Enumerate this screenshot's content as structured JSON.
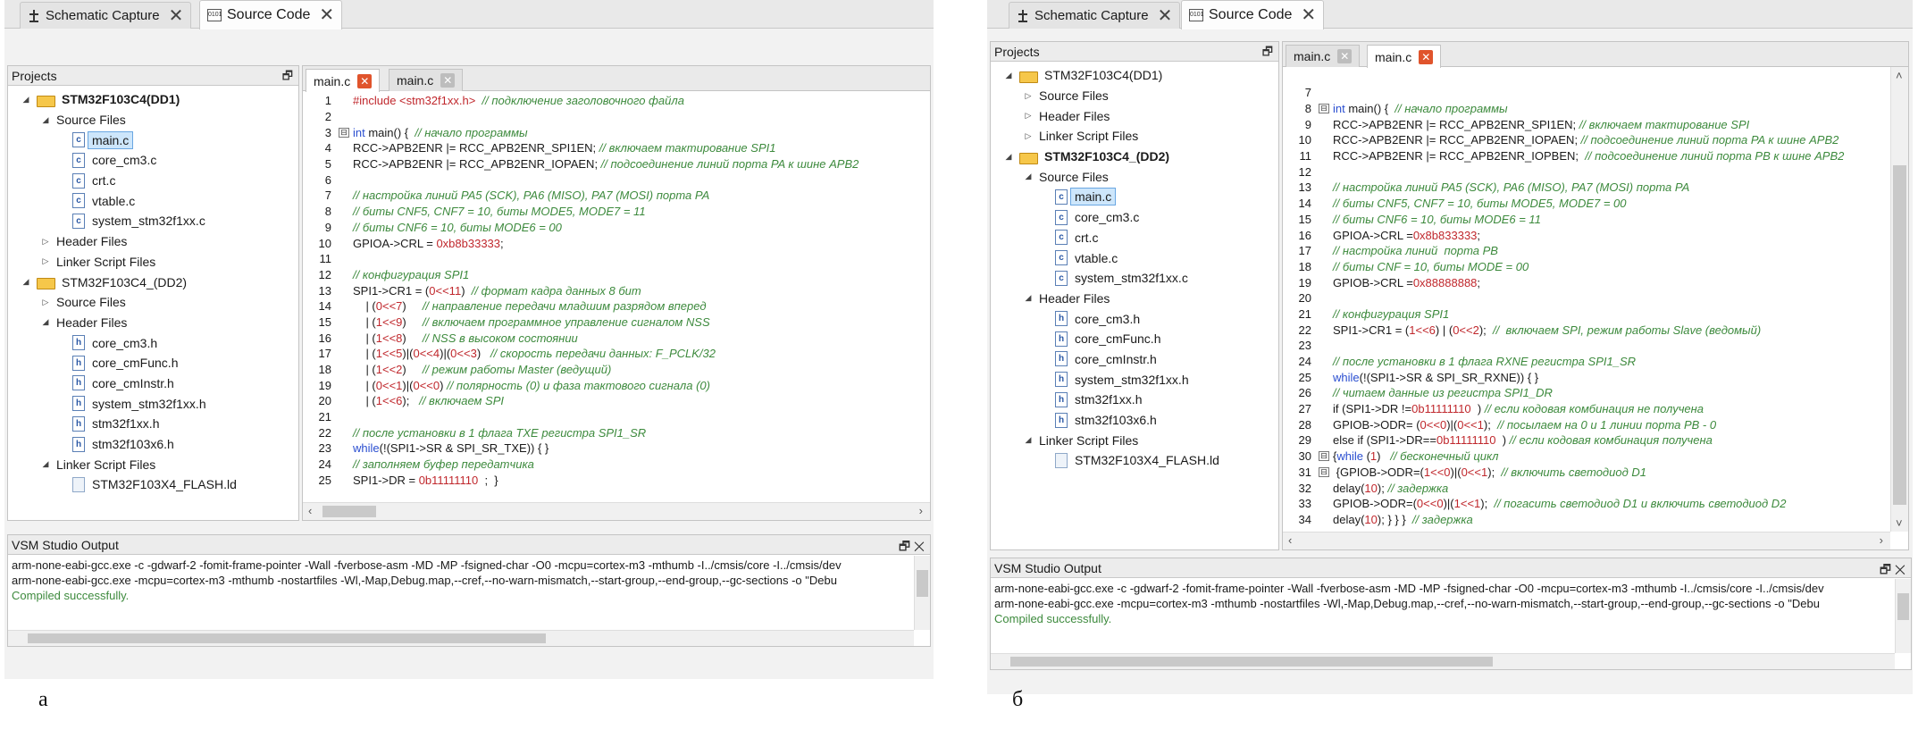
{
  "tabs": {
    "schematic": "Schematic Capture",
    "source": "Source Code"
  },
  "projects_title": "Projects",
  "output_title": "VSM Studio Output",
  "output_lines": [
    "arm-none-eabi-gcc.exe -c -gdwarf-2 -fomit-frame-pointer -Wall -fverbose-asm -MD -MP -fsigned-char -O0 -mcpu=cortex-m3 -mthumb -I../cmsis/core -I../cmsis/dev",
    "arm-none-eabi-gcc.exe -mcpu=cortex-m3 -mthumb -nostartfiles  -Wl,-Map,Debug.map,--cref,--no-warn-mismatch,--start-group,--end-group,--gc-sections -o \"Debu",
    "Compiled successfully."
  ],
  "output_lines_b": [
    "arm-none-eabi-gcc.exe -c -gdwarf-2 -fomit-frame-pointer -Wall -fverbose-asm -MD -MP -fsigned-char -O0 -mcpu=cortex-m3 -mthumb -I../cmsis/core -I../cmsis/dev",
    "arm-none-eabi-gcc.exe -mcpu=cortex-m3 -mthumb -nostartfiles  -Wl,-Map,Debug.map,--cref,--no-warn-mismatch,--start-group,--end-group,--gc-sections -o \"Debu",
    "Compiled successfully."
  ],
  "panel_a": {
    "caption": "а",
    "tree": [
      {
        "t": "STM32F103C4(DD1)",
        "lvl": 0,
        "arrow": "◢",
        "icon": "folder",
        "bold": true
      },
      {
        "t": "Source Files",
        "lvl": 1,
        "arrow": "◢",
        "icon": ""
      },
      {
        "t": "main.c",
        "lvl": 2,
        "arrow": "",
        "icon": "c",
        "sel": true
      },
      {
        "t": "core_cm3.c",
        "lvl": 2,
        "arrow": "",
        "icon": "c"
      },
      {
        "t": "crt.c",
        "lvl": 2,
        "arrow": "",
        "icon": "c"
      },
      {
        "t": "vtable.c",
        "lvl": 2,
        "arrow": "",
        "icon": "c"
      },
      {
        "t": "system_stm32f1xx.c",
        "lvl": 2,
        "arrow": "",
        "icon": "c"
      },
      {
        "t": "Header Files",
        "lvl": 1,
        "arrow": "▷",
        "icon": ""
      },
      {
        "t": "Linker Script Files",
        "lvl": 1,
        "arrow": "▷",
        "icon": ""
      },
      {
        "t": "STM32F103C4_(DD2)",
        "lvl": 0,
        "arrow": "◢",
        "icon": "folder"
      },
      {
        "t": "Source Files",
        "lvl": 1,
        "arrow": "▷",
        "icon": ""
      },
      {
        "t": "Header Files",
        "lvl": 1,
        "arrow": "◢",
        "icon": ""
      },
      {
        "t": "core_cm3.h",
        "lvl": 2,
        "arrow": "",
        "icon": "h"
      },
      {
        "t": "core_cmFunc.h",
        "lvl": 2,
        "arrow": "",
        "icon": "h"
      },
      {
        "t": "core_cmInstr.h",
        "lvl": 2,
        "arrow": "",
        "icon": "h"
      },
      {
        "t": "system_stm32f1xx.h",
        "lvl": 2,
        "arrow": "",
        "icon": "h"
      },
      {
        "t": "stm32f1xx.h",
        "lvl": 2,
        "arrow": "",
        "icon": "h"
      },
      {
        "t": "stm32f103x6.h",
        "lvl": 2,
        "arrow": "",
        "icon": "h"
      },
      {
        "t": "Linker Script Files",
        "lvl": 1,
        "arrow": "◢",
        "icon": ""
      },
      {
        "t": "STM32F103X4_FLASH.ld",
        "lvl": 2,
        "arrow": "",
        "icon": "ld"
      }
    ],
    "editor_tabs": [
      {
        "label": "main.c",
        "active": true,
        "close": "red"
      },
      {
        "label": "main.c",
        "active": false,
        "close": "grey"
      }
    ],
    "code": [
      {
        "n": "1",
        "fold": "",
        "segs": [
          [
            "pp",
            "#include <stm32f1xx.h>"
          ],
          [
            "",
            "  "
          ],
          [
            "cm",
            "// подключение заголовочного файла"
          ]
        ]
      },
      {
        "n": "2",
        "fold": "",
        "segs": []
      },
      {
        "n": "3",
        "fold": "⊟",
        "segs": [
          [
            "kw",
            "int"
          ],
          [
            "",
            " main() {  "
          ],
          [
            "cm",
            "// начало программы"
          ]
        ]
      },
      {
        "n": "4",
        "fold": "",
        "segs": [
          [
            "",
            "RCC->APB2ENR |= RCC_APB2ENR_SPI1EN; "
          ],
          [
            "cm",
            "// включаем тактирование SPI1"
          ]
        ]
      },
      {
        "n": "5",
        "fold": "",
        "segs": [
          [
            "",
            "RCC->APB2ENR |= RCC_APB2ENR_IOPAEN; "
          ],
          [
            "cm",
            "// подсоединение линий порта PA к шине APB2"
          ]
        ]
      },
      {
        "n": "6",
        "fold": "",
        "segs": []
      },
      {
        "n": "7",
        "fold": "",
        "segs": [
          [
            "cm",
            "// настройка линий PA5 (SCK), PA6 (MISO), PA7 (MOSI) порта PA"
          ]
        ]
      },
      {
        "n": "8",
        "fold": "",
        "segs": [
          [
            "cm",
            "// биты CNF5, CNF7 = 10, биты MODE5, MODE7 = 11"
          ]
        ]
      },
      {
        "n": "9",
        "fold": "",
        "segs": [
          [
            "cm",
            "// биты CNF6 = 10, биты MODE6 = 00"
          ]
        ]
      },
      {
        "n": "10",
        "fold": "",
        "segs": [
          [
            "",
            "GPIOA->CRL = "
          ],
          [
            "nm",
            "0xb8b33333"
          ],
          [
            "",
            ";"
          ]
        ]
      },
      {
        "n": "11",
        "fold": "",
        "segs": []
      },
      {
        "n": "12",
        "fold": "",
        "segs": [
          [
            "cm",
            "// конфигурация SPI1"
          ]
        ]
      },
      {
        "n": "13",
        "fold": "",
        "segs": [
          [
            "",
            "SPI1->CR1 = ("
          ],
          [
            "nm",
            "0<<11"
          ],
          [
            "",
            ")  "
          ],
          [
            "cm",
            "// формат кадра данных 8 бит"
          ]
        ]
      },
      {
        "n": "14",
        "fold": "",
        "segs": [
          [
            "",
            "    | ("
          ],
          [
            "nm",
            "0<<7"
          ],
          [
            "",
            ")     "
          ],
          [
            "cm",
            "// направление передачи младшим разрядом вперед"
          ]
        ]
      },
      {
        "n": "15",
        "fold": "",
        "segs": [
          [
            "",
            "    | ("
          ],
          [
            "nm",
            "1<<9"
          ],
          [
            "",
            ")     "
          ],
          [
            "cm",
            "// включаем программное управление сигналом NSS"
          ]
        ]
      },
      {
        "n": "16",
        "fold": "",
        "segs": [
          [
            "",
            "    | ("
          ],
          [
            "nm",
            "1<<8"
          ],
          [
            "",
            ")     "
          ],
          [
            "cm",
            "// NSS в высоком состоянии"
          ]
        ]
      },
      {
        "n": "17",
        "fold": "",
        "segs": [
          [
            "",
            "    | ("
          ],
          [
            "nm",
            "1<<5"
          ],
          [
            "",
            ")|("
          ],
          [
            "nm",
            "0<<4"
          ],
          [
            "",
            ")|("
          ],
          [
            "nm",
            "0<<3"
          ],
          [
            "",
            ")   "
          ],
          [
            "cm",
            "// скорость передачи данных: F_PCLK/32"
          ]
        ]
      },
      {
        "n": "18",
        "fold": "",
        "segs": [
          [
            "",
            "    | ("
          ],
          [
            "nm",
            "1<<2"
          ],
          [
            "",
            ")     "
          ],
          [
            "cm",
            "// режим работы Master (ведущий)"
          ]
        ]
      },
      {
        "n": "19",
        "fold": "",
        "segs": [
          [
            "",
            "    | ("
          ],
          [
            "nm",
            "0<<1"
          ],
          [
            "",
            ")|("
          ],
          [
            "nm",
            "0<<0"
          ],
          [
            "",
            ") "
          ],
          [
            "cm",
            "// полярность (0) и фаза тактового сигнала (0)"
          ]
        ]
      },
      {
        "n": "20",
        "fold": "",
        "segs": [
          [
            "",
            "    | ("
          ],
          [
            "nm",
            "1<<6"
          ],
          [
            "",
            ");   "
          ],
          [
            "cm",
            "// включаем SPI"
          ]
        ]
      },
      {
        "n": "21",
        "fold": "",
        "segs": []
      },
      {
        "n": "22",
        "fold": "",
        "segs": [
          [
            "cm",
            "// после установки в 1 флага TXE регистра SPI1_SR"
          ]
        ]
      },
      {
        "n": "23",
        "fold": "",
        "segs": [
          [
            "kw",
            "while"
          ],
          [
            "",
            "(!(SPI1->SR & SPI_SR_TXE)) { }"
          ]
        ]
      },
      {
        "n": "24",
        "fold": "",
        "segs": [
          [
            "cm",
            "// заполняем буфер передатчика"
          ]
        ]
      },
      {
        "n": "25",
        "fold": "",
        "segs": [
          [
            "",
            "SPI1->DR = "
          ],
          [
            "nm",
            "0b11111110"
          ],
          [
            "",
            "  ;  }"
          ]
        ]
      }
    ]
  },
  "panel_b": {
    "caption": "б",
    "tree": [
      {
        "t": "STM32F103C4(DD1)",
        "lvl": 0,
        "arrow": "◢",
        "icon": "folder"
      },
      {
        "t": "Source Files",
        "lvl": 1,
        "arrow": "▷",
        "icon": ""
      },
      {
        "t": "Header Files",
        "lvl": 1,
        "arrow": "▷",
        "icon": ""
      },
      {
        "t": "Linker Script Files",
        "lvl": 1,
        "arrow": "▷",
        "icon": ""
      },
      {
        "t": "STM32F103C4_(DD2)",
        "lvl": 0,
        "arrow": "◢",
        "icon": "folder",
        "bold": true
      },
      {
        "t": "Source Files",
        "lvl": 1,
        "arrow": "◢",
        "icon": ""
      },
      {
        "t": "main.c",
        "lvl": 2,
        "arrow": "",
        "icon": "c",
        "sel": true
      },
      {
        "t": "core_cm3.c",
        "lvl": 2,
        "arrow": "",
        "icon": "c"
      },
      {
        "t": "crt.c",
        "lvl": 2,
        "arrow": "",
        "icon": "c"
      },
      {
        "t": "vtable.c",
        "lvl": 2,
        "arrow": "",
        "icon": "c"
      },
      {
        "t": "system_stm32f1xx.c",
        "lvl": 2,
        "arrow": "",
        "icon": "c"
      },
      {
        "t": "Header Files",
        "lvl": 1,
        "arrow": "◢",
        "icon": ""
      },
      {
        "t": "core_cm3.h",
        "lvl": 2,
        "arrow": "",
        "icon": "h"
      },
      {
        "t": "core_cmFunc.h",
        "lvl": 2,
        "arrow": "",
        "icon": "h"
      },
      {
        "t": "core_cmInstr.h",
        "lvl": 2,
        "arrow": "",
        "icon": "h"
      },
      {
        "t": "system_stm32f1xx.h",
        "lvl": 2,
        "arrow": "",
        "icon": "h"
      },
      {
        "t": "stm32f1xx.h",
        "lvl": 2,
        "arrow": "",
        "icon": "h"
      },
      {
        "t": "stm32f103x6.h",
        "lvl": 2,
        "arrow": "",
        "icon": "h"
      },
      {
        "t": "Linker Script Files",
        "lvl": 1,
        "arrow": "◢",
        "icon": ""
      },
      {
        "t": "STM32F103X4_FLASH.ld",
        "lvl": 2,
        "arrow": "",
        "icon": "ld"
      }
    ],
    "editor_tabs": [
      {
        "label": "main.c",
        "active": false,
        "close": "grey"
      },
      {
        "label": "main.c",
        "active": true,
        "close": "red"
      }
    ],
    "code": [
      {
        "n": "7",
        "fold": "",
        "segs": []
      },
      {
        "n": "8",
        "fold": "⊟",
        "segs": [
          [
            "kw",
            "int"
          ],
          [
            "",
            " main() {  "
          ],
          [
            "cm",
            "// начало программы"
          ]
        ]
      },
      {
        "n": "9",
        "fold": "",
        "segs": [
          [
            "",
            "RCC->APB2ENR |= RCC_APB2ENR_SPI1EN; "
          ],
          [
            "cm",
            "// включаем тактирование SPI"
          ]
        ]
      },
      {
        "n": "10",
        "fold": "",
        "segs": [
          [
            "",
            "RCC->APB2ENR |= RCC_APB2ENR_IOPAEN; "
          ],
          [
            "cm",
            "// подсоединение линий порта PA к шине APB2"
          ]
        ]
      },
      {
        "n": "11",
        "fold": "",
        "segs": [
          [
            "",
            "RCC->APB2ENR |= RCC_APB2ENR_IOPBEN;  "
          ],
          [
            "cm",
            "// подсоединение линий порта PB к шине APB2"
          ]
        ]
      },
      {
        "n": "12",
        "fold": "",
        "segs": []
      },
      {
        "n": "13",
        "fold": "",
        "segs": [
          [
            "cm",
            "// настройка линий PA5 (SCK), PA6 (MISO), PA7 (MOSI) порта PA"
          ]
        ]
      },
      {
        "n": "14",
        "fold": "",
        "segs": [
          [
            "cm",
            "// биты CNF5, CNF7 = 10, биты MODE5, MODE7 = 00"
          ]
        ]
      },
      {
        "n": "15",
        "fold": "",
        "segs": [
          [
            "cm",
            "// биты CNF6 = 10, биты MODE6 = 11"
          ]
        ]
      },
      {
        "n": "16",
        "fold": "",
        "segs": [
          [
            "",
            "GPIOA->CRL ="
          ],
          [
            "nm",
            "0x8b833333"
          ],
          [
            "",
            ";"
          ]
        ]
      },
      {
        "n": "17",
        "fold": "",
        "segs": [
          [
            "cm",
            "// настройка линий  порта PB"
          ]
        ]
      },
      {
        "n": "18",
        "fold": "",
        "segs": [
          [
            "cm",
            "// биты CNF = 10, биты MODE = 00"
          ]
        ]
      },
      {
        "n": "19",
        "fold": "",
        "segs": [
          [
            "",
            "GPIOB->CRL ="
          ],
          [
            "nm",
            "0x88888888"
          ],
          [
            "",
            ";"
          ]
        ]
      },
      {
        "n": "20",
        "fold": "",
        "segs": []
      },
      {
        "n": "21",
        "fold": "",
        "segs": [
          [
            "cm",
            "// конфигурация SPI1"
          ]
        ]
      },
      {
        "n": "22",
        "fold": "",
        "segs": [
          [
            "",
            "SPI1->CR1 = ("
          ],
          [
            "nm",
            "1<<6"
          ],
          [
            "",
            ") | ("
          ],
          [
            "nm",
            "0<<2"
          ],
          [
            "",
            ");  "
          ],
          [
            "cm",
            "//  включаем SPI, режим работы Slave (ведомый)"
          ]
        ]
      },
      {
        "n": "23",
        "fold": "",
        "segs": []
      },
      {
        "n": "24",
        "fold": "",
        "segs": [
          [
            "cm",
            "// после установки в 1 флага RXNE регистра SPI1_SR"
          ]
        ]
      },
      {
        "n": "25",
        "fold": "",
        "segs": [
          [
            "kw",
            "while"
          ],
          [
            "",
            "(!(SPI1->SR & SPI_SR_RXNE)) { }"
          ]
        ]
      },
      {
        "n": "26",
        "fold": "",
        "segs": [
          [
            "cm",
            "// читаем данные из регистра SPI1_DR"
          ]
        ]
      },
      {
        "n": "27",
        "fold": "",
        "segs": [
          [
            "",
            "if (SPI1->DR !="
          ],
          [
            "nm",
            "0b11111110"
          ],
          [
            "",
            "  ) "
          ],
          [
            "cm",
            "// если кодовая комбинация не получена"
          ]
        ]
      },
      {
        "n": "28",
        "fold": "",
        "segs": [
          [
            "",
            "GPIOB->ODR= ("
          ],
          [
            "nm",
            "0<<0"
          ],
          [
            "",
            ")|("
          ],
          [
            "nm",
            "0<<1"
          ],
          [
            "",
            ");  "
          ],
          [
            "cm",
            "// посылаем на 0 и 1 линии порта PB - 0"
          ]
        ]
      },
      {
        "n": "29",
        "fold": "",
        "segs": [
          [
            "",
            "else if (SPI1->DR=="
          ],
          [
            "nm",
            "0b11111110"
          ],
          [
            "",
            "  ) "
          ],
          [
            "cm",
            "// если кодовая комбинация получена"
          ]
        ]
      },
      {
        "n": "30",
        "fold": "⊟",
        "segs": [
          [
            "",
            "{"
          ],
          [
            "kw",
            "while"
          ],
          [
            "",
            " ("
          ],
          [
            "nm",
            "1"
          ],
          [
            "",
            ")   "
          ],
          [
            "cm",
            "// бесконечный цикл"
          ]
        ]
      },
      {
        "n": "31",
        "fold": "⊟",
        "segs": [
          [
            "",
            " {GPIOB->ODR=("
          ],
          [
            "nm",
            "1<<0"
          ],
          [
            "",
            ")|("
          ],
          [
            "nm",
            "0<<1"
          ],
          [
            "",
            ");  "
          ],
          [
            "cm",
            "// включить светодиод D1"
          ]
        ]
      },
      {
        "n": "32",
        "fold": "",
        "segs": [
          [
            "",
            "delay("
          ],
          [
            "nm",
            "10"
          ],
          [
            "",
            "); "
          ],
          [
            "cm",
            "// задержка"
          ]
        ]
      },
      {
        "n": "33",
        "fold": "",
        "segs": [
          [
            "",
            "GPIOB->ODR=("
          ],
          [
            "nm",
            "0<<0"
          ],
          [
            "",
            ")|("
          ],
          [
            "nm",
            "1<<1"
          ],
          [
            "",
            ");  "
          ],
          [
            "cm",
            "// погасить светодиод D1 и включить светодиод D2"
          ]
        ]
      },
      {
        "n": "34",
        "fold": "",
        "segs": [
          [
            "",
            "delay("
          ],
          [
            "nm",
            "10"
          ],
          [
            "",
            "); } } }  "
          ],
          [
            "cm",
            "// задержка"
          ]
        ]
      }
    ]
  }
}
